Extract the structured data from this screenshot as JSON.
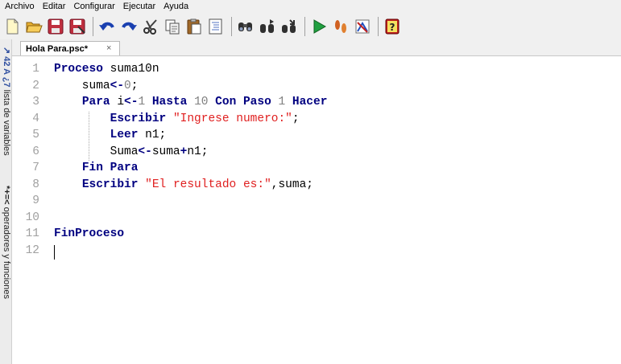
{
  "menu": {
    "items": [
      "Archivo",
      "Editar",
      "Configurar",
      "Ejecutar",
      "Ayuda"
    ]
  },
  "toolbar": {
    "groups": [
      [
        "new-file-icon",
        "open-folder-icon",
        "save-icon",
        "save-as-icon"
      ],
      [
        "undo-icon",
        "redo-icon",
        "cut-icon",
        "copy-icon",
        "paste-icon",
        "indent-icon"
      ],
      [
        "find-icon",
        "find-next-icon",
        "replace-icon"
      ],
      [
        "run-icon",
        "step-by-step-icon",
        "debug-icon"
      ],
      [
        "help-icon"
      ]
    ]
  },
  "left_panel": {
    "variables_label": "lista de variables",
    "variables_symbols": "*+=<",
    "operators_label": "operadores y funciones",
    "operators_symbols": "↗ 42 A ¿7"
  },
  "tab": {
    "title": "Hola Para.psc*",
    "close": "×"
  },
  "editor": {
    "line_numbers": [
      "1",
      "2",
      "3",
      "4",
      "5",
      "6",
      "7",
      "8",
      "9",
      "10",
      "11",
      "12"
    ],
    "lines": [
      [
        {
          "t": "Proceso",
          "c": "kw"
        },
        {
          "t": " suma10n",
          "c": ""
        }
      ],
      [
        {
          "t": "    suma",
          "c": ""
        },
        {
          "t": "<-",
          "c": "op"
        },
        {
          "t": "0",
          "c": "num"
        },
        {
          "t": ";",
          "c": ""
        }
      ],
      [
        {
          "t": "    ",
          "c": ""
        },
        {
          "t": "Para",
          "c": "kw"
        },
        {
          "t": " i",
          "c": ""
        },
        {
          "t": "<-",
          "c": "op"
        },
        {
          "t": "1",
          "c": "num"
        },
        {
          "t": " ",
          "c": ""
        },
        {
          "t": "Hasta",
          "c": "kw"
        },
        {
          "t": " ",
          "c": ""
        },
        {
          "t": "10",
          "c": "num"
        },
        {
          "t": " ",
          "c": ""
        },
        {
          "t": "Con Paso",
          "c": "kw"
        },
        {
          "t": " ",
          "c": ""
        },
        {
          "t": "1",
          "c": "num"
        },
        {
          "t": " ",
          "c": ""
        },
        {
          "t": "Hacer",
          "c": "kw"
        }
      ],
      [
        {
          "t": "        ",
          "c": ""
        },
        {
          "t": "Escribir",
          "c": "kw"
        },
        {
          "t": " ",
          "c": ""
        },
        {
          "t": "\"Ingrese numero:\"",
          "c": "str"
        },
        {
          "t": ";",
          "c": ""
        }
      ],
      [
        {
          "t": "        ",
          "c": ""
        },
        {
          "t": "Leer",
          "c": "kw"
        },
        {
          "t": " n1;",
          "c": ""
        }
      ],
      [
        {
          "t": "        Suma",
          "c": ""
        },
        {
          "t": "<-",
          "c": "op"
        },
        {
          "t": "suma",
          "c": ""
        },
        {
          "t": "+",
          "c": "op"
        },
        {
          "t": "n1;",
          "c": ""
        }
      ],
      [
        {
          "t": "    ",
          "c": ""
        },
        {
          "t": "Fin Para",
          "c": "kw"
        }
      ],
      [
        {
          "t": "    ",
          "c": ""
        },
        {
          "t": "Escribir",
          "c": "kw"
        },
        {
          "t": " ",
          "c": ""
        },
        {
          "t": "\"El resultado es:\"",
          "c": "str"
        },
        {
          "t": ",suma;",
          "c": ""
        }
      ],
      [],
      [],
      [
        {
          "t": "FinProceso",
          "c": "kw"
        }
      ],
      []
    ]
  },
  "colors": {
    "keyword": "#000080",
    "string": "#e02020",
    "number": "#808080",
    "line_number": "#a0a0a0"
  }
}
